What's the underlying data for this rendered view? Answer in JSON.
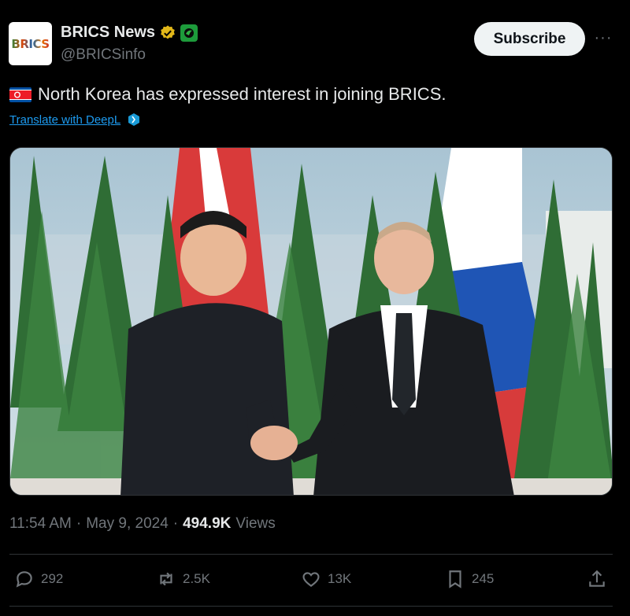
{
  "account": {
    "avatar_text": "BRICS",
    "display_name": "BRICS News",
    "handle": "@BRICSinfo"
  },
  "buttons": {
    "subscribe": "Subscribe",
    "more": "···"
  },
  "tweet": {
    "text": "North Korea has expressed interest in joining BRICS.",
    "translate_link": "Translate with DeepL"
  },
  "meta": {
    "time": "11:54 AM",
    "date": "May 9, 2024",
    "views_count": "494.9K",
    "views_label": "Views",
    "separator": "·"
  },
  "actions": {
    "replies": "292",
    "reposts": "2.5K",
    "likes": "13K",
    "bookmarks": "245"
  },
  "colors": {
    "background": "#000000",
    "text_primary": "#e7e9ea",
    "text_secondary": "#71767b",
    "link": "#1d9bf0",
    "verified_gold": "#e2b719"
  },
  "icons": {
    "verified": "gold-verified-badge-icon",
    "affiliate": "brics-affiliate-badge-icon",
    "flag": "north-korea-flag-icon",
    "deepl": "deepl-icon",
    "reply": "reply-icon",
    "repost": "repost-icon",
    "like": "heart-icon",
    "bookmark": "bookmark-icon",
    "share": "share-icon"
  }
}
